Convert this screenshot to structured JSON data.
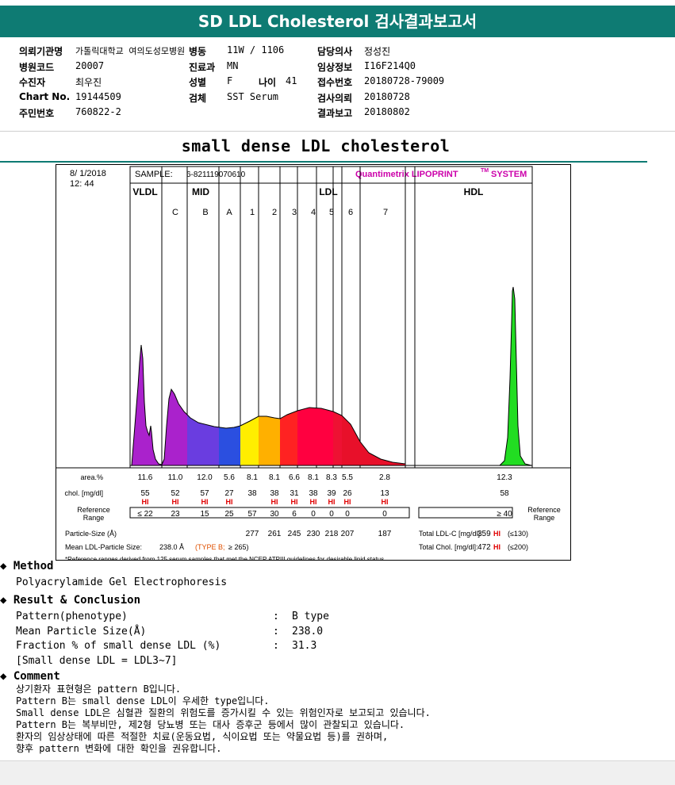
{
  "header": {
    "title": "SD LDL Cholesterol 검사결과보고서"
  },
  "info": {
    "col1": [
      {
        "label": "의뢰기관명",
        "value": "가톨릭대학교 여의도성모병원"
      },
      {
        "label": "병원코드",
        "value": "20007"
      },
      {
        "label": "수진자",
        "value": "최우진"
      },
      {
        "label": "Chart No.",
        "value": "19144509"
      },
      {
        "label": "주민번호",
        "value": "760822-2"
      }
    ],
    "col2": [
      {
        "label": "병동",
        "value": "11W / 1106"
      },
      {
        "label": "진료과",
        "value": "MN"
      },
      {
        "label": "성별",
        "value": "F"
      },
      {
        "label": "검체",
        "value": "SST Serum"
      }
    ],
    "age": {
      "label": "나이",
      "value": "41"
    },
    "col3": [
      {
        "label": "담당의사",
        "value": "정성진"
      },
      {
        "label": "임상정보",
        "value": "I16F214Q0"
      },
      {
        "label": "접수번호",
        "value": "20180728-79009"
      },
      {
        "label": "검사의뢰",
        "value": "20180728"
      },
      {
        "label": "결과보고",
        "value": "20180802"
      }
    ]
  },
  "section_title": "small dense LDL cholesterol",
  "chart_data": {
    "type": "area",
    "date": "8/ 1/2018",
    "time": "12: 44",
    "sample_label": "SAMPLE:",
    "sample_id": "6-821119070610",
    "system": "Quantimetrix LIPOPRINT",
    "system_tm": "TM",
    "system_suffix": "SYSTEM",
    "groups": [
      "VLDL",
      "MID",
      "LDL",
      "HDL"
    ],
    "bands": [
      "C",
      "B",
      "A",
      "1",
      "2",
      "3",
      "4",
      "5",
      "6",
      "7"
    ],
    "band_colors": [
      "#aa22cc",
      "#6a3de0",
      "#1e5ae8",
      "#ffee00",
      "#ffaa00",
      "#ff2222",
      "#ff0033",
      "#ff0044",
      "#ee1133",
      "#dd0022",
      "#00cc00"
    ],
    "table": {
      "area_label": "area.%",
      "area": [
        "11.6",
        "11.0",
        "12.0",
        "5.6",
        "8.1",
        "8.1",
        "6.6",
        "8.1",
        "8.3",
        "5.5",
        "2.8",
        "12.3"
      ],
      "chol_label": "chol. [mg/dl]",
      "chol": [
        "55",
        "52",
        "57",
        "27",
        "38",
        "38",
        "31",
        "38",
        "39",
        "26",
        "13",
        "58"
      ],
      "hi_flag": "HI",
      "hi": [
        true,
        true,
        true,
        true,
        false,
        true,
        true,
        true,
        true,
        true,
        true,
        false
      ],
      "ref_label": "Reference Range",
      "ref": [
        "≤ 22",
        "23",
        "15",
        "25",
        "57",
        "30",
        "6",
        "0",
        "0",
        "0",
        "0",
        "≥ 40"
      ],
      "particle_label": "Particle-Size (Å)",
      "particle": [
        "277",
        "261",
        "245",
        "230",
        "218",
        "207",
        "187"
      ],
      "total_ldl_label": "Total LDL-C [mg/dl]:",
      "total_ldl": "359",
      "total_ldl_ref": "(≤130)",
      "total_chol_label": "Total Chol. [mg/dl]:",
      "total_chol": "472",
      "total_chol_ref": "(≤200)",
      "mean_label": "Mean LDL-Particle Size:",
      "mean_value": "238.0 Å",
      "mean_type": "(TYPE B;",
      "mean_ref": "≥ 265)",
      "footnote": "*Reference ranges derived from 125 serum samples that met the NCEP ATPIII guidelines for desirable lipid status"
    }
  },
  "method": {
    "heading": "Method",
    "text": "Polyacrylamide Gel Electrophoresis"
  },
  "result": {
    "heading": "Result & Conclusion",
    "rows": [
      {
        "label": "Pattern(phenotype)",
        "value": "B type"
      },
      {
        "label": "Mean Particle Size(Å)",
        "value": "238.0"
      },
      {
        "label": "Fraction % of small dense LDL (%)",
        "value": "31.3"
      }
    ],
    "note": "[Small dense LDL = LDL3~7]"
  },
  "comment": {
    "heading": "Comment",
    "lines": [
      "상기환자 표현형은 pattern B입니다.",
      "Pattern B는 small dense LDL이 우세한 type입니다.",
      "Small dense LDL은 심혈관 질환의 위험도를 증가시킬 수 있는 위험인자로 보고되고 있습니다.",
      "Pattern B는 복부비만, 제2형 당뇨병 또는 대사 증후군 등에서 많이 관찰되고 있습니다.",
      "환자의 임상상태에 따른 적절한 치료(운동요법, 식이요법 또는 약물요법 등)를 권하며,",
      "향후 pattern 변화에 대한 확인을 권유합니다."
    ]
  }
}
